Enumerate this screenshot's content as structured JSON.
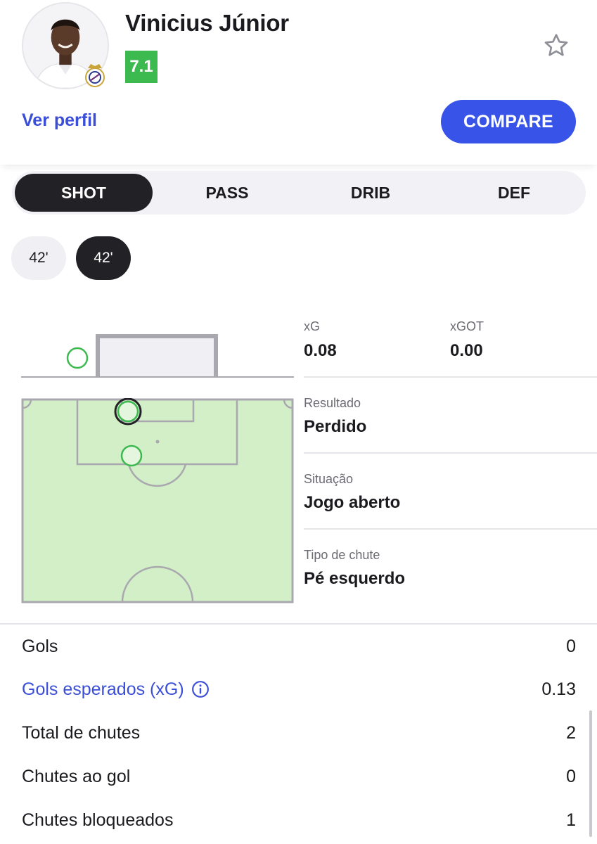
{
  "player": {
    "name": "Vinicius Júnior",
    "rating": "7.1",
    "rating_color": "#3cb94f",
    "profile_link": "Ver perfil",
    "compare_label": "COMPARE",
    "favorite_icon": "star-outline-icon"
  },
  "tabs": [
    {
      "label": "SHOT",
      "active": true
    },
    {
      "label": "PASS",
      "active": false
    },
    {
      "label": "DRIB",
      "active": false
    },
    {
      "label": "DEF",
      "active": false
    }
  ],
  "minute_chips": [
    {
      "label": "42'",
      "selected": false
    },
    {
      "label": "42'",
      "selected": true
    }
  ],
  "shot_detail": {
    "xg_label": "xG",
    "xg_value": "0.08",
    "xgot_label": "xGOT",
    "xgot_value": "0.00",
    "result_label": "Resultado",
    "result_value": "Perdido",
    "situation_label": "Situação",
    "situation_value": "Jogo aberto",
    "shot_type_label": "Tipo de chute",
    "shot_type_value": "Pé esquerdo"
  },
  "stats": [
    {
      "label": "Gols",
      "value": "0",
      "link": false
    },
    {
      "label": "Gols esperados (xG)",
      "value": "0.13",
      "link": true
    },
    {
      "label": "Total de chutes",
      "value": "2",
      "link": false
    },
    {
      "label": "Chutes ao gol",
      "value": "0",
      "link": false
    },
    {
      "label": "Chutes bloqueados",
      "value": "1",
      "link": false
    }
  ],
  "colors": {
    "accent": "#3853e8",
    "link": "#3b4ed8",
    "pitch": "#d3efc8",
    "shot_marker": "#3cb94f",
    "dark": "#222226"
  }
}
